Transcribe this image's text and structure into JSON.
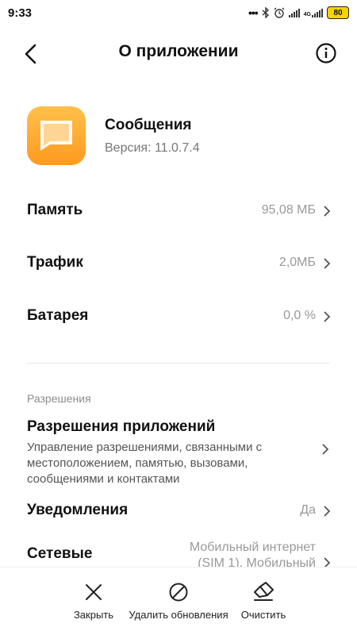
{
  "status_bar": {
    "time": "9:33",
    "network_label": "4G",
    "battery": "80"
  },
  "header": {
    "title": "О приложении"
  },
  "app": {
    "name": "Сообщения",
    "version": "Версия: 11.0.7.4",
    "icon": "messages-icon",
    "icon_color": "#ffa62b"
  },
  "rows": {
    "memory": {
      "label": "Память",
      "value": "95,08 МБ"
    },
    "traffic": {
      "label": "Трафик",
      "value": "2,0МБ"
    },
    "battery": {
      "label": "Батарея",
      "value": "0,0 %"
    }
  },
  "permissions_section": {
    "header": "Разрешения",
    "title": "Разрешения приложений",
    "description": "Управление разрешениями, связанными с местоположением, памятью, вызовами, сообщениями и контактами"
  },
  "notifications": {
    "label": "Уведомления",
    "value": "Да"
  },
  "network": {
    "label": "Сетевые",
    "value_line1": "Мобильный интернет",
    "value_line2": "(SIM 1), Мобильный"
  },
  "bottom_actions": {
    "close": "Закрыть",
    "uninstall_updates": "Удалить обновления",
    "clear": "Очистить"
  }
}
